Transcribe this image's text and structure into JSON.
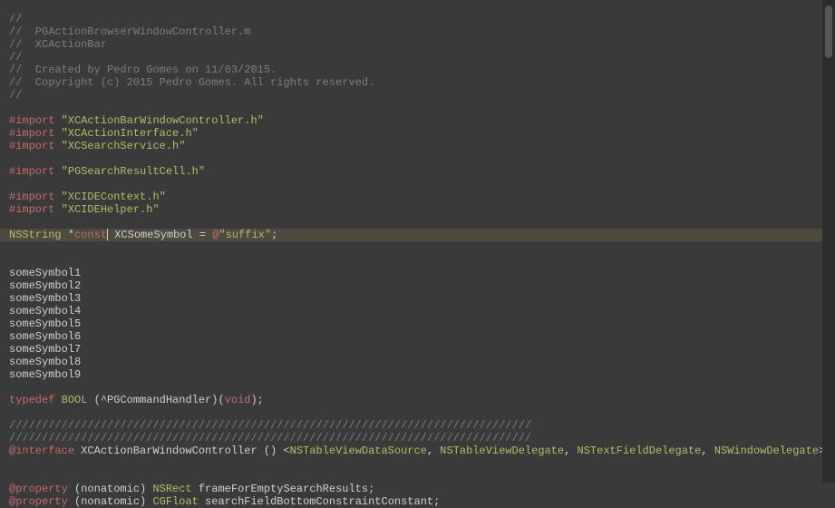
{
  "header": {
    "l1": "//",
    "l2": "//  PGActionBrowserWindowController.m",
    "l3": "//  XCActionBar",
    "l4": "//",
    "l5": "//  Created by Pedro Gomes on 11/03/2015.",
    "l6": "//  Copyright (c) 2015 Pedro Gomes. All rights reserved.",
    "l7": "//"
  },
  "imports": {
    "kw": "#import",
    "h1": "\"XCActionBarWindowController.h\"",
    "h2": "\"XCActionInterface.h\"",
    "h3": "\"XCSearchService.h\"",
    "h4": "\"PGSearchResultCell.h\"",
    "h5": "\"XCIDEContext.h\"",
    "h6": "\"XCIDEHelper.h\""
  },
  "decl": {
    "type": "NSString",
    "star": " *",
    "const": "const",
    "name": " XCSomeSymbol = ",
    "at": "@",
    "str": "\"suffix\"",
    "semi": ";"
  },
  "symbols": {
    "s1": "someSymbol1",
    "s2": "someSymbol2",
    "s3": "someSymbol3",
    "s4": "someSymbol4",
    "s5": "someSymbol5",
    "s6": "someSymbol6",
    "s7": "someSymbol7",
    "s8": "someSymbol8",
    "s9": "someSymbol9"
  },
  "typedef": {
    "kw": "typedef",
    "type": "BOOL",
    "mid": " (^PGCommandHandler)(",
    "void": "void",
    "end": ");"
  },
  "divider": "////////////////////////////////////////////////////////////////////////////////",
  "interface": {
    "kw": "@interface",
    "name": " XCActionBarWindowController () <",
    "p1": "NSTableViewDataSource",
    "p2": "NSTableViewDelegate",
    "p3": "NSTextFieldDelegate",
    "p4": "NSWindowDelegate",
    "gt": ">",
    "comma": ", "
  },
  "props": {
    "kw": "@property",
    "attrs": " (nonatomic) ",
    "t1": "NSRect",
    "n1": " frameForEmptySearchResults;",
    "t2": "CGFloat",
    "n2": " searchFieldBottomConstraintConstant;"
  }
}
